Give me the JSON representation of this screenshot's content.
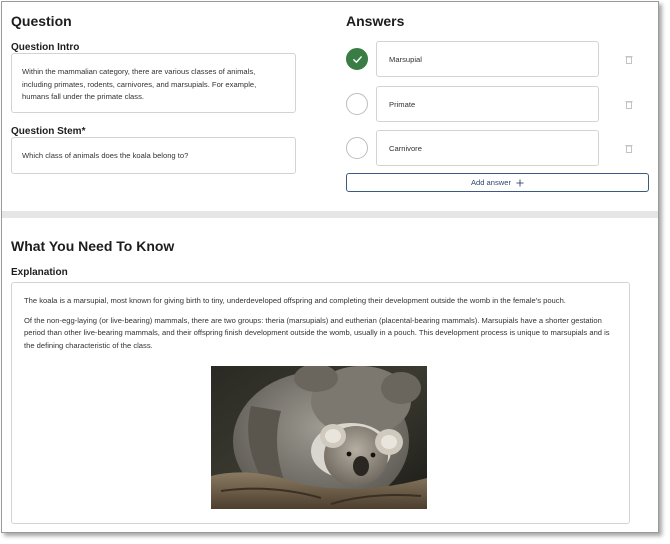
{
  "question": {
    "heading": "Question",
    "intro_label": "Question Intro",
    "intro_text": "Within the mammalian category, there are various classes of animals, including primates, rodents, carnivores, and marsupials. For example, humans fall under the primate class.",
    "stem_label": "Question Stem*",
    "stem_text": "Which class of animals does the koala belong to?"
  },
  "answers": {
    "heading": "Answers",
    "items": [
      {
        "label": "Marsupial",
        "selected": true
      },
      {
        "label": "Primate",
        "selected": false
      },
      {
        "label": "Carnivore",
        "selected": false
      }
    ],
    "add_label": "Add answer",
    "add_icon": "plus-icon",
    "selected_color": "#3a7d44"
  },
  "know": {
    "heading": "What You Need To Know",
    "explanation_label": "Explanation",
    "paragraph1": "The koala is a marsupial, most known for giving birth to tiny, underdeveloped offspring and completing their development outside the womb in the female's pouch.",
    "paragraph2": "Of the non-egg-laying (or live-bearing) mammals, there are two groups: theria (marsupials) and eutherian (placental-bearing mammals). Marsupials have a shorter gestation period than other live-bearing mammals, and their offspring finish development outside the womb, usually in a pouch. This development process is unique to marsupials and is the defining characteristic of the class."
  }
}
